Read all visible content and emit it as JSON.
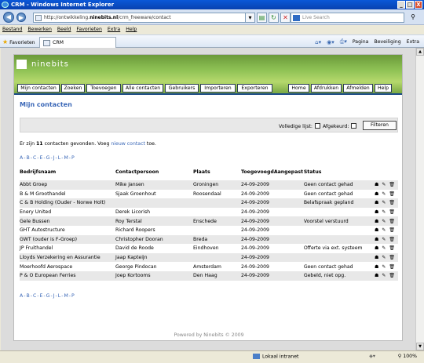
{
  "window": {
    "title": "CRM - Windows Internet Explorer",
    "min": "_",
    "max": "□",
    "close": "X"
  },
  "address": {
    "prefix": "http://ontwikkeling.",
    "domain": "ninebits.nl",
    "path": "/crm_freeware/contact"
  },
  "search": {
    "placeholder": "Live Search"
  },
  "menubar": [
    "Bestand",
    "Bewerken",
    "Beeld",
    "Favorieten",
    "Extra",
    "Help"
  ],
  "favbar": {
    "favorites": "Favorieten",
    "tab": "CRM",
    "commands": [
      "Pagina",
      "Beveiliging",
      "Extra"
    ]
  },
  "logo": {
    "text": "ninebits"
  },
  "nav": {
    "left": [
      "Mijn contacten",
      "Zoeken",
      "Toevoegen",
      "Alle contacten",
      "Gebruikers",
      "Importeren",
      "Exporteren"
    ],
    "right": [
      "Home",
      "Afdrukken",
      "Afmelden",
      "Help"
    ]
  },
  "page": {
    "title": "Mijn contacten"
  },
  "filter": {
    "volledige": "Volledige lijst:",
    "afgekeurd": "Afgekeurd:",
    "button": "Filteren"
  },
  "found": {
    "pre": "Er zijn ",
    "count": "11",
    "mid": " contacten gevonden. Voeg ",
    "link": "nieuw contact",
    "post": " toe."
  },
  "alpha": [
    "A",
    "B",
    "C",
    "E",
    "G",
    "J",
    "L",
    "M",
    "P"
  ],
  "table": {
    "headers": [
      "Bedrijfsnaam",
      "Contactpersoon",
      "Plaats",
      "Toegevoegd",
      "Aangepast",
      "Status"
    ],
    "rows": [
      [
        "Abbt Groep",
        "Mike Jansen",
        "Groningen",
        "24-09-2009",
        "",
        "Geen contact gehad"
      ],
      [
        "B & M Groothandel",
        "Sjaak Groenhout",
        "Roosendaal",
        "24-09-2009",
        "",
        "Geen contact gehad"
      ],
      [
        "C & B Holding (Ouder - Norwe Holt)",
        "",
        "",
        "24-09-2009",
        "",
        "Belafspraak gepland"
      ],
      [
        "Enery United",
        "Derek Licorish",
        "",
        "24-09-2009",
        "",
        ""
      ],
      [
        "Gele Bussen",
        "Roy Terstal",
        "Enschede",
        "24-09-2009",
        "",
        "Voorstel verstuurd"
      ],
      [
        "GHT Autostructure",
        "Richard Roopers",
        "",
        "24-09-2009",
        "",
        ""
      ],
      [
        "GWT (ouder is F-Groep)",
        "Christopher Dooran",
        "Breda",
        "24-09-2009",
        "",
        ""
      ],
      [
        "JP Fruithandel",
        "David de Roode",
        "Eindhoven",
        "24-09-2009",
        "",
        "Offerte via ext. systeem"
      ],
      [
        "Lloyds Verzekering en Assurantie",
        "Jaap Kapteijn",
        "",
        "24-09-2009",
        "",
        ""
      ],
      [
        "Moerhoofd Aerospace",
        "George Pindocan",
        "Amsterdam",
        "24-09-2009",
        "",
        "Geen contact gehad"
      ],
      [
        "P & O European Ferries",
        "Joep Kortooms",
        "Den Haag",
        "24-09-2009",
        "",
        "Gebeld, niet opg."
      ]
    ]
  },
  "footer": "Powered by Ninebits © 2009",
  "status": {
    "zone": "Lokaal intranet",
    "zoom": "100%"
  }
}
